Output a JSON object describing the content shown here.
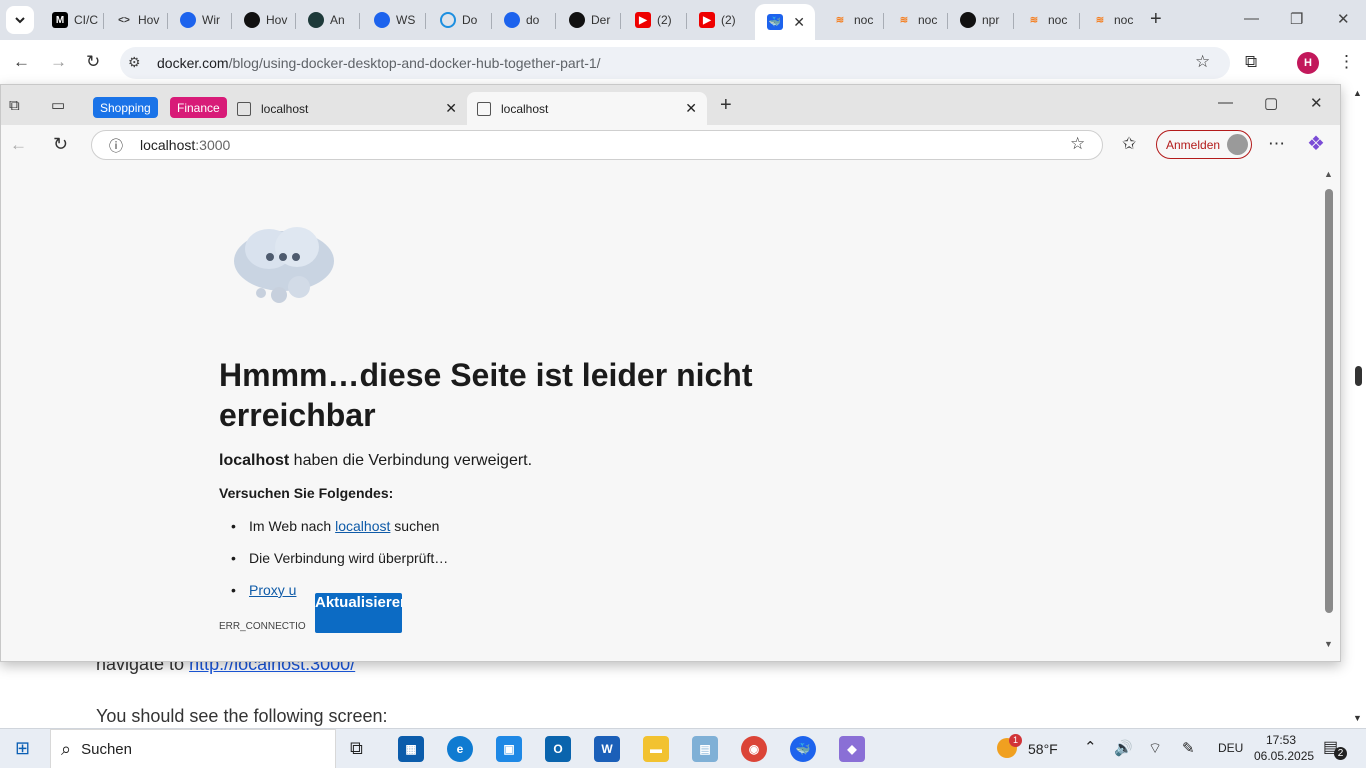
{
  "chrome": {
    "tabs": [
      {
        "label": "CI/C",
        "icon": "M"
      },
      {
        "label": "Hov",
        "icon": "<>"
      },
      {
        "label": "Wir",
        "icon": "D"
      },
      {
        "label": "Hov",
        "icon": "GH"
      },
      {
        "label": "An",
        "icon": "P"
      },
      {
        "label": "WS",
        "icon": "D"
      },
      {
        "label": "Do",
        "icon": "Q"
      },
      {
        "label": "do",
        "icon": "D"
      },
      {
        "label": "Der",
        "icon": "GH"
      },
      {
        "label": "(2)",
        "icon": "YT"
      },
      {
        "label": "(2)",
        "icon": "YT"
      },
      {
        "label": "",
        "icon": "docker"
      },
      {
        "label": "noc",
        "icon": "SO"
      },
      {
        "label": "noc",
        "icon": "SO"
      },
      {
        "label": "npr",
        "icon": "GH"
      },
      {
        "label": "noc",
        "icon": "SO"
      },
      {
        "label": "noc",
        "icon": "SO"
      }
    ],
    "url_host": "docker.com",
    "url_path": "/blog/using-docker-desktop-and-docker-hub-together-part-1/",
    "profile_letter": "H"
  },
  "background_page": {
    "line1_prefix": "navigate to ",
    "line1_link": "http://localhost:3000/",
    "line2": "You should see the following screen:"
  },
  "edge": {
    "pill_shopping": "Shopping",
    "pill_finance": "Finance",
    "tab1_label": "localhost",
    "tab2_label": "localhost",
    "address_host": "localhost",
    "address_port": ":3000",
    "signin_label": "Anmelden",
    "error": {
      "title": "Hmmm…diese Seite ist leider nicht erreichbar",
      "host": "localhost",
      "message": " haben die Verbindung verweigert.",
      "try_heading": "Versuchen Sie Folgendes:",
      "suggestion1_prefix": "Im Web nach ",
      "suggestion1_link": "localhost",
      "suggestion1_suffix": " suchen",
      "suggestion2": "Die Verbindung wird überprüft…",
      "suggestion3_link": "Proxy u",
      "code": "ERR_CONNECTIO",
      "reload_button": "Aktualisieren"
    }
  },
  "taskbar": {
    "search_label": "Suchen",
    "weather_temp": "58°F",
    "weather_badge": "1",
    "language": "DEU",
    "time": "17:53",
    "date": "06.05.2025",
    "notifications": "2"
  },
  "colors": {
    "shopping": "#1a73e8",
    "finance": "#d81b78",
    "reload_button": "#0c6bc4",
    "link": "#0f5ba8",
    "signin": "#b31b1b"
  }
}
